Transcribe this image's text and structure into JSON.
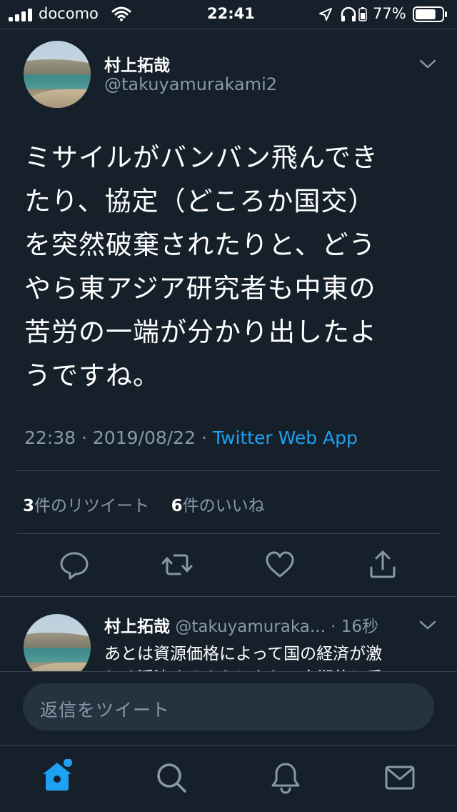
{
  "status_bar": {
    "carrier": "docomo",
    "time": "22:41",
    "battery": "77%",
    "battery_level": 0.77
  },
  "tweet": {
    "author_name": "村上拓哉",
    "author_handle": "@takuyamurakami2",
    "text": "ミサイルがバンバン飛んでき\nたり、協定（どころか国交）\nを突然破棄されたりと、どう\nやら東アジア研究者も中東の\n苦労の一端が分かり出したよ\nうですね。",
    "time": "22:38",
    "date": "2019/08/22",
    "separator": "·",
    "source": "Twitter Web App",
    "retweet_count": "3",
    "retweet_label": "件のリツイート",
    "like_count": "6",
    "like_label": "件のいいね"
  },
  "reply_tweet": {
    "author_name": "村上拓哉",
    "author_handle": "@takuyamuraka...",
    "age": "· 16秒",
    "text_line1": "あとは資源価格によって国の経済が激",
    "text_line2": "しく浮沈するようになり、定期的に反"
  },
  "compose": {
    "placeholder": "返信をツイート"
  },
  "colors": {
    "background": "#15202b",
    "accent": "#1da1f2",
    "muted": "#8899a6",
    "divider": "#38444d",
    "input_bg": "#253341"
  },
  "icons": {
    "actions": [
      "reply-icon",
      "retweet-icon",
      "like-icon",
      "share-icon"
    ],
    "nav": [
      "home-icon",
      "search-icon",
      "notifications-icon",
      "messages-icon"
    ]
  }
}
